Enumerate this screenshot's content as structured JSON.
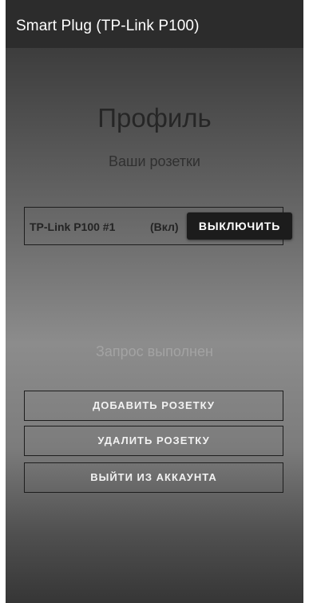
{
  "app_bar": {
    "title": "Smart Plug (TP-Link P100)"
  },
  "profile": {
    "title": "Профиль",
    "subtitle": "Ваши розетки"
  },
  "plugs": [
    {
      "name": "TP-Link P100 #1",
      "status": "(Вкл)",
      "toggle_label": "ВЫКЛЮЧИТЬ"
    }
  ],
  "status_message": "Запрос выполнен",
  "actions": {
    "add_label": "ДОБАВИТЬ РОЗЕТКУ",
    "remove_label": "УДАЛИТЬ РОЗЕТКУ",
    "logout_label": "ВЫЙТИ ИЗ АККАУНТА"
  },
  "colors": {
    "app_bar_background": "#2c2c2c",
    "primary_button_background": "#1c1c1c",
    "button_text": "#ffffff"
  }
}
